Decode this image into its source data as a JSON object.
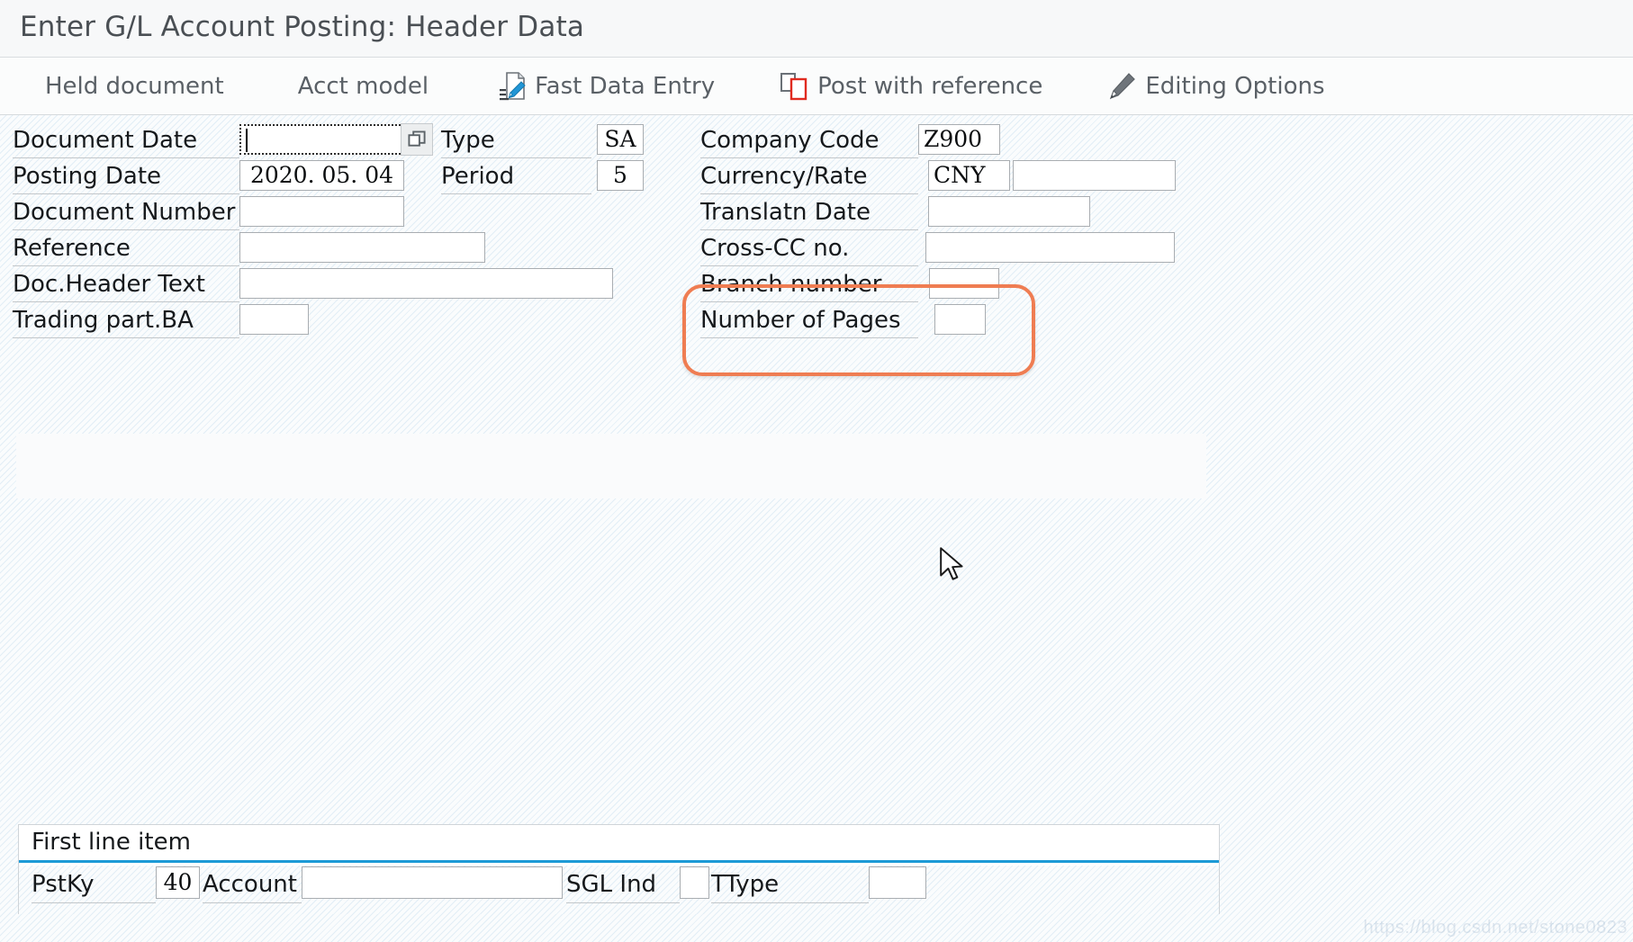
{
  "window": {
    "title": "Enter G/L Account Posting: Header Data"
  },
  "toolbar": {
    "items": [
      {
        "label": "Held document",
        "icon": ""
      },
      {
        "label": "Acct model",
        "icon": ""
      },
      {
        "label": "Fast Data Entry",
        "icon": "fast-data-entry-icon"
      },
      {
        "label": "Post with reference",
        "icon": "post-with-reference-icon"
      },
      {
        "label": "Editing Options",
        "icon": "pencil-icon"
      }
    ]
  },
  "header_form": {
    "left_column": [
      {
        "label": "Document Date",
        "value": "",
        "placeholder": "",
        "has_matchcode": true,
        "focused": true
      },
      {
        "label": "Posting Date",
        "value": "2020. 05. 04",
        "placeholder": ""
      },
      {
        "label": "Document Number",
        "value": "",
        "placeholder": ""
      },
      {
        "label": "Reference",
        "value": "",
        "placeholder": ""
      },
      {
        "label": "Doc.Header Text",
        "value": "",
        "placeholder": ""
      },
      {
        "label": "Trading part.BA",
        "value": "",
        "placeholder": ""
      }
    ],
    "middle_column": [
      {
        "label": "Type",
        "value": "SA",
        "placeholder": ""
      },
      {
        "label": "Period",
        "value": "5",
        "placeholder": ""
      }
    ],
    "right_column": [
      {
        "label": "Company Code",
        "value": "Z900",
        "placeholder": ""
      },
      {
        "label": "Currency/Rate",
        "value": "CNY",
        "value2": "",
        "placeholder": ""
      },
      {
        "label": "Translatn Date",
        "value": "",
        "placeholder": ""
      },
      {
        "label": "Cross-CC no.",
        "value": "",
        "placeholder": ""
      },
      {
        "label": "Branch number",
        "value": "",
        "placeholder": ""
      },
      {
        "label": "Number of Pages",
        "value": "",
        "placeholder": ""
      }
    ]
  },
  "annotation": {
    "shape": "rounded-rectangle",
    "color": "#ef7d52",
    "targets": [
      "Branch number",
      "Number of Pages"
    ]
  },
  "first_line_item": {
    "section_title": "First line item",
    "fields": [
      {
        "label": "PstKy",
        "value": "40"
      },
      {
        "label": "Account",
        "value": ""
      },
      {
        "label": "SGL Ind",
        "value": ""
      },
      {
        "label": "TType",
        "value": ""
      }
    ]
  },
  "watermark": {
    "text": "https://blog.csdn.net/stone0823"
  },
  "colors": {
    "accent_blue": "#1c9ad6",
    "annotation_orange": "#ef7d52",
    "icon_blue": "#2196d6",
    "icon_red": "#e02b20",
    "title_text": "#4a4f54",
    "hatch_blue": "#aacde6"
  }
}
